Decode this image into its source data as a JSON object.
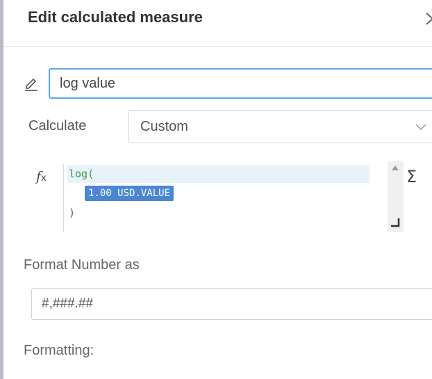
{
  "panel": {
    "title": "Edit calculated measure"
  },
  "name_field": {
    "value": "log value"
  },
  "calculate": {
    "label": "Calculate",
    "selected": "Custom"
  },
  "formula": {
    "line1": "log(",
    "token": "1.00 USD.VALUE",
    "line3": ")"
  },
  "icons": {
    "edit": "pencil-icon",
    "fx": "fx",
    "sigma": "Σ",
    "close": "chevron-right-icon"
  },
  "format": {
    "label": "Format Number as",
    "placeholder": "#,###.##"
  },
  "formatting": {
    "label": "Formatting:"
  },
  "colors": {
    "accent_border": "#5da8e6",
    "token_bg": "#4a86d1",
    "function_text": "#3f9a3f"
  }
}
